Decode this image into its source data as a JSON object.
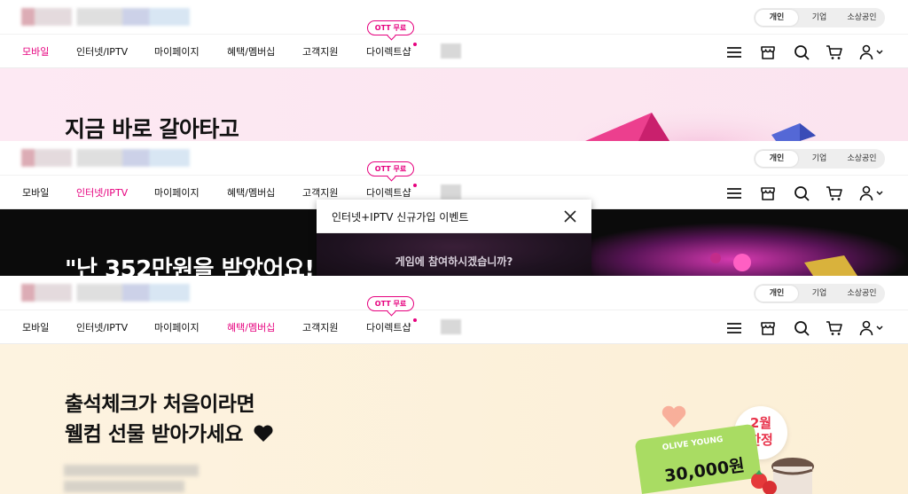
{
  "topbar": {
    "segments": [
      "개인",
      "기업",
      "소상공인"
    ],
    "active_segment": "개인"
  },
  "nav": {
    "items": [
      "모바일",
      "인터넷/IPTV",
      "마이페이지",
      "혜택/멤버십",
      "고객지원",
      "다이렉트샵"
    ],
    "ott_badge": "OTT 무료"
  },
  "colors": {
    "accent": "#e6007e",
    "hero1_bg": "#fde7f1",
    "hero3_bg": "#fdf1da"
  },
  "icons": [
    "menu-icon",
    "store-icon",
    "search-icon",
    "cart-icon",
    "user-icon",
    "chevron-down-icon",
    "close-icon",
    "heart-icon"
  ],
  "sections": [
    {
      "active_nav": "모바일",
      "hero_title": "지금 바로 갈아타고"
    },
    {
      "active_nav": "인터넷/IPTV",
      "hero_title": "\"난 352만원을 받았어요!\"",
      "popup": {
        "title": "인터넷+IPTV 신규가입 이벤트",
        "body": "게임에 참여하시겠습니까?"
      }
    },
    {
      "active_nav": "혜택/멤버십",
      "hero_title_line1": "출석체크가 처음이라면",
      "hero_title_line2": "웰컴 선물 받아가세요",
      "badge": {
        "line1": "2월",
        "line2": "한정"
      },
      "card_brand": "OLIVE YOUNG",
      "card_amount": "30,000원"
    }
  ]
}
